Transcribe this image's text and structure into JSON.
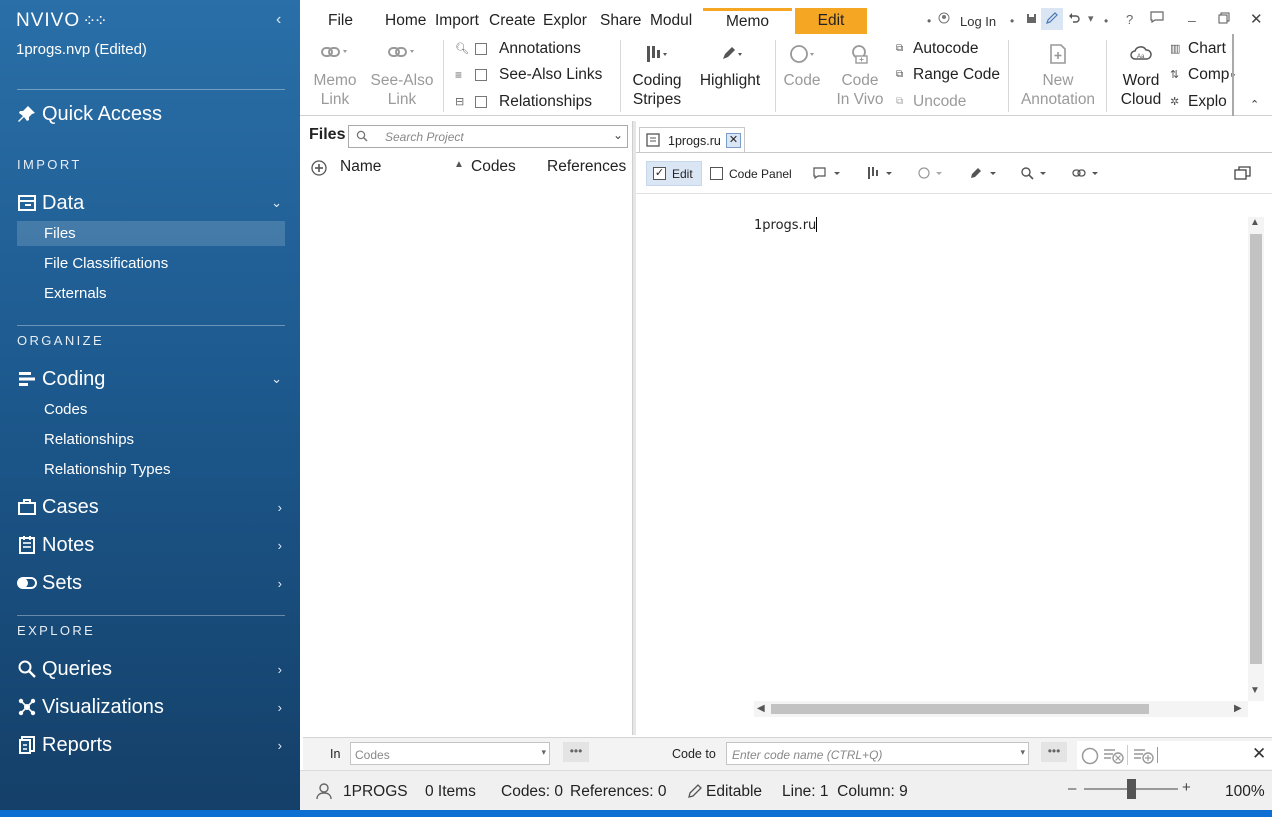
{
  "app": {
    "logo": "NVIVO",
    "project": "1progs.nvp (Edited)"
  },
  "sidebar": {
    "quick_access": "Quick Access",
    "sections": {
      "import": "IMPORT",
      "organize": "ORGANIZE",
      "explore": "EXPLORE"
    },
    "data": {
      "label": "Data",
      "items": [
        "Files",
        "File Classifications",
        "Externals"
      ]
    },
    "coding": {
      "label": "Coding",
      "items": [
        "Codes",
        "Relationships",
        "Relationship Types"
      ]
    },
    "cases": "Cases",
    "notes": "Notes",
    "sets": "Sets",
    "queries": "Queries",
    "visualizations": "Visualizations",
    "reports": "Reports"
  },
  "ribbon_tabs": {
    "file": "File",
    "home": "Home",
    "import": "Import",
    "create": "Create",
    "explore": "Explor",
    "share": "Share",
    "module": "Modul",
    "memo": "Memo",
    "edit": "Edit",
    "login": "Log In"
  },
  "ribbon": {
    "memo_link": [
      "Memo",
      "Link"
    ],
    "see_also_link": [
      "See-Also",
      "Link"
    ],
    "annotations": "Annotations",
    "see_also_links": "See-Also Links",
    "relationships": "Relationships",
    "coding_stripes": [
      "Coding",
      "Stripes"
    ],
    "highlight": "Highlight",
    "code": "Code",
    "code_in_vivo": [
      "Code",
      "In Vivo"
    ],
    "autocode": "Autocode",
    "range_code": "Range Code",
    "uncode": "Uncode",
    "new_annotation": [
      "New",
      "Annotation"
    ],
    "word_cloud": [
      "Word",
      "Cloud"
    ],
    "chart": "Chart",
    "compare": "Comp",
    "explore": "Explo"
  },
  "files_panel": {
    "title": "Files",
    "search_placeholder": "Search Project",
    "columns": [
      "Name",
      "Codes",
      "References"
    ]
  },
  "document": {
    "tab_title": "1progs.ru",
    "edit_label": "Edit",
    "edit_checked": true,
    "code_panel_label": "Code Panel",
    "content": "1progs.ru"
  },
  "codebar": {
    "in_label": "In",
    "in_placeholder": "Codes",
    "code_to_label": "Code to",
    "code_to_placeholder": "Enter code name (CTRL+Q)"
  },
  "status": {
    "user": "1PROGS",
    "items": "0 Items",
    "codes": "Codes: 0",
    "references": "References: 0",
    "editable": "Editable",
    "line_col": "Line: 1  Column: 9",
    "zoom": "100%",
    "zoom_level": 0.5
  }
}
